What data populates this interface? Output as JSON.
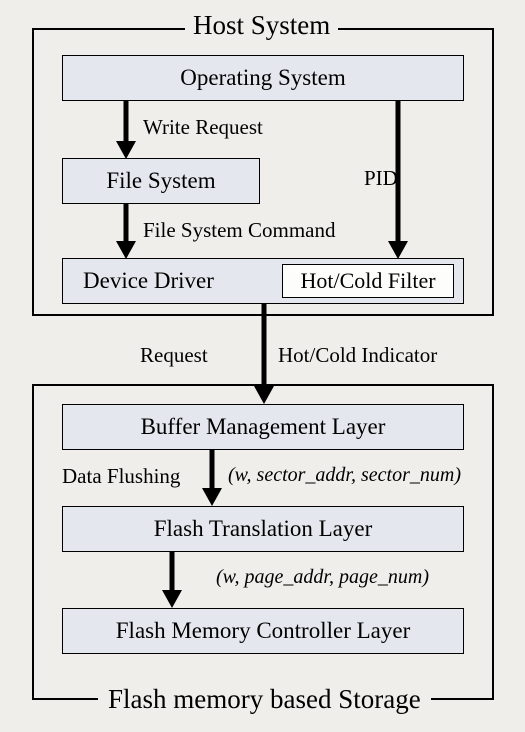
{
  "host": {
    "title": "Host System",
    "os": "Operating System",
    "file_system": "File System",
    "device_driver": "Device Driver",
    "hot_cold_filter": "Hot/Cold Filter",
    "write_request": "Write Request",
    "pid": "PID",
    "fs_command": "File System Command"
  },
  "mid": {
    "request": "Request",
    "hc_indicator": "Hot/Cold Indicator"
  },
  "storage": {
    "title": "Flash memory based Storage",
    "buffer": "Buffer Management Layer",
    "ftl": "Flash Translation Layer",
    "controller": "Flash Memory Controller Layer",
    "data_flushing": "Data Flushing",
    "sector_params": "(w, sector_addr, sector_num)",
    "page_params": "(w, page_addr, page_num)"
  }
}
